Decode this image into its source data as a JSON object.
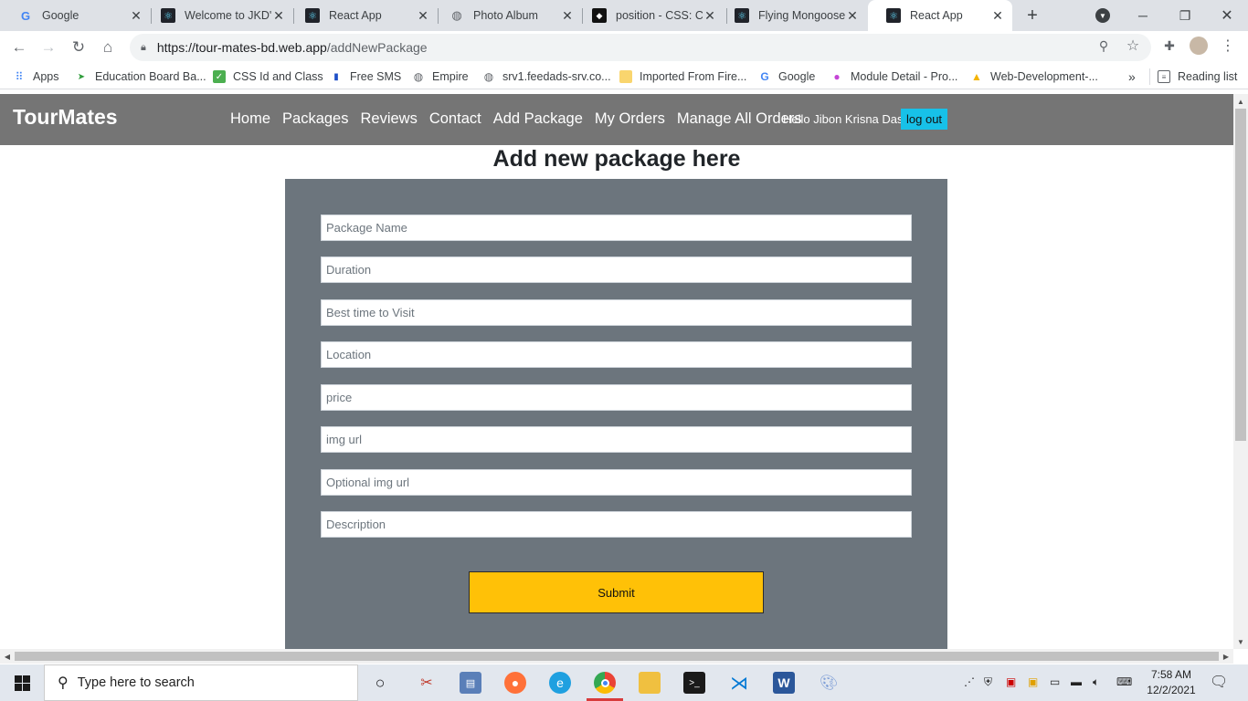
{
  "browser": {
    "tabs": [
      {
        "title": "Google",
        "icon": "google-icon"
      },
      {
        "title": "Welcome to JKD's",
        "icon": "react-icon"
      },
      {
        "title": "React App",
        "icon": "react-icon"
      },
      {
        "title": "Photo Album",
        "icon": "globe-icon"
      },
      {
        "title": "position - CSS: Ca",
        "icon": "codepen-icon"
      },
      {
        "title": "Flying Mongoose",
        "icon": "react-icon"
      },
      {
        "title": "React App",
        "icon": "react-icon",
        "active": true
      }
    ],
    "url_host": "https://tour-mates-bd.web.app",
    "url_path": "/addNewPackage",
    "bookmarks": [
      "Apps",
      "Education Board Ba...",
      "CSS Id and Class",
      "Free SMS",
      "Empire",
      "srv1.feedads-srv.co...",
      "Imported From Fire...",
      "Google",
      "Module Detail - Pro...",
      "Web-Development-..."
    ],
    "overflow": "»",
    "reading_list": "Reading list"
  },
  "site": {
    "brand": "TourMates",
    "nav": [
      "Home",
      "Packages",
      "Reviews",
      "Contact",
      "Add Package",
      "My Orders",
      "Manage All Orders"
    ],
    "greeting": "Hello Jibon Krisna Das",
    "logout": "log out",
    "heading": "Add new package here",
    "fields": [
      "Package Name",
      "Duration",
      "Best time to Visit",
      "Location",
      "price",
      "img url",
      "Optional img url",
      "Description"
    ],
    "submit": "Submit"
  },
  "taskbar": {
    "search_placeholder": "Type here to search",
    "time": "7:58 AM",
    "date": "12/2/2021"
  },
  "colors": {
    "navbar": "#757575",
    "form_bg": "#6c757d",
    "submit": "#ffc107",
    "logout": "#17c1e8"
  }
}
